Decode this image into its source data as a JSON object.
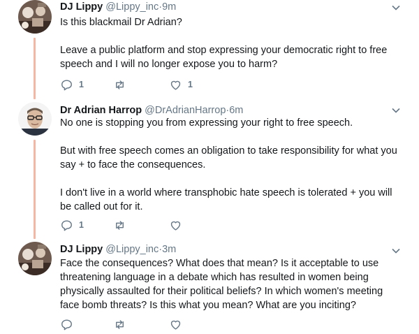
{
  "tweets": [
    {
      "name": "DJ Lippy",
      "handle": "@Lippy_inc",
      "separator": "·",
      "time": "9m",
      "paragraphs": [
        "Is this blackmail Dr Adrian?",
        "Leave a public platform and stop expressing your democratic right to free speech and I will no longer expose you to harm?"
      ],
      "replies": "1",
      "retweets": "",
      "likes": "1"
    },
    {
      "name": "Dr Adrian Harrop",
      "handle": "@DrAdrianHarrop",
      "separator": "·",
      "time": "6m",
      "paragraphs": [
        "No one is stopping you from expressing your right to free speech.",
        "But with free speech comes an obligation to take responsibility for what you say + to face the consequences.",
        "I don't live in a world where transphobic hate speech is tolerated + you will be called out for it."
      ],
      "replies": "1",
      "retweets": "",
      "likes": ""
    },
    {
      "name": "DJ Lippy",
      "handle": "@Lippy_inc",
      "separator": "·",
      "time": "3m",
      "paragraphs": [
        "Face the consequences? What does that mean? Is it acceptable to use threatening language in a debate which has resulted in women being physically assaulted for their political beliefs? In which women's meeting face bomb threats? Is this what you mean? What are you inciting?"
      ],
      "replies": "",
      "retweets": "",
      "likes": ""
    }
  ],
  "colors": {
    "thread_line": "#f5b7a1",
    "muted": "#657786",
    "text": "#14171a"
  },
  "icons": [
    "reply-icon",
    "retweet-icon",
    "like-icon",
    "chevron-down-icon"
  ]
}
